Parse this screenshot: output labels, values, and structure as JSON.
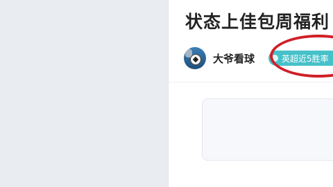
{
  "article": {
    "title": "状态上佳包周福利",
    "author": {
      "name": "大爷看球",
      "avatar_icon": "soccer-ball-icon"
    },
    "stat_badge": {
      "label": "英超近5胜率"
    }
  },
  "colors": {
    "sidebar_bg": "#e9ecf0",
    "badge_bg": "#47c1c9",
    "highlight_ring": "#d01f27",
    "card_bg": "#f7f8fb"
  }
}
